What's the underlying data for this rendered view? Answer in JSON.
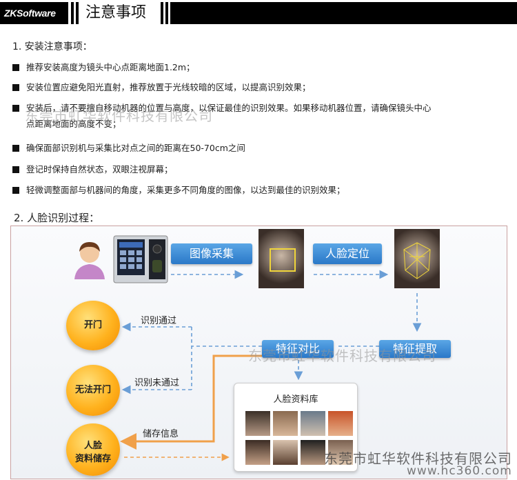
{
  "header": {
    "logo": "ZKSoftware",
    "title": "注意事项"
  },
  "section1": {
    "heading": "1. 安装注意事项：",
    "items": [
      "推荐安装高度为镜头中心点距离地面1.2m；",
      "安装位置应避免阳光直射，推荐放置于光线较暗的区域，以提高识别效果；",
      "安装后，请不要擅自移动机器的位置与高度，以保证最佳的识别效果。如果移动机器位置，请确保镜头中心",
      "点距离地面的高度不变；",
      "确保面部识别机与采集比对点之间的距离在50-70cm之间",
      "登记时保持自然状态，双眼注视屏幕；",
      "轻微调整面部与机器间的角度，采集更多不同角度的图像，以达到最佳的识别效果；"
    ]
  },
  "section2": {
    "heading": "2. 人脸识别过程："
  },
  "diagram": {
    "capture": "图像采集",
    "locate": "人脸定位",
    "compare": "特征对比",
    "extract": "特征提取",
    "open": "开门",
    "cannot_open": "无法开门",
    "store_line1": "人脸",
    "store_line2": "资料储存",
    "pass_label": "识别通过",
    "fail_label": "识别未通过",
    "store_label": "储存信息",
    "db_title": "人脸资料库"
  },
  "watermark": {
    "company": "东莞市虹华软件科技有限公司",
    "url": "www.hc360.com"
  },
  "colors": {
    "accent_blue": "#2a78c8",
    "orb_orange": "#ffb21e",
    "arrow_blue": "#6a9ed6",
    "arrow_orange": "#f0a04a"
  }
}
